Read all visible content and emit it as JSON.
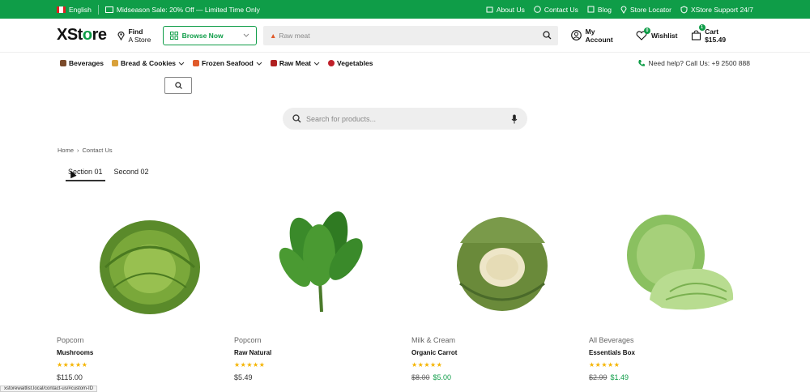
{
  "topbar": {
    "language": "English",
    "promo": "Midseason Sale: 20% Off — Limited Time Only",
    "links": [
      "About Us",
      "Contact Us",
      "Blog",
      "Store Locator",
      "XStore Support 24/7"
    ]
  },
  "header": {
    "logo_prefix": "XSt",
    "logo_o": "o",
    "logo_suffix": "re",
    "find_line1": "Find",
    "find_line2": "A Store",
    "browse_label": "Browse Now",
    "search_placeholder": "Raw meat",
    "account_label": "My Account",
    "wishlist_label": "Wishlist",
    "wishlist_count": "0",
    "cart_label": "Cart $15.49",
    "cart_count": "1"
  },
  "nav": {
    "categories": [
      {
        "label": "Beverages",
        "color": "#7a4a2a"
      },
      {
        "label": "Bread & Cookies",
        "color": "#d9a13a"
      },
      {
        "label": "Frozen Seafood",
        "color": "#e05a2a"
      },
      {
        "label": "Raw Meat",
        "color": "#b02020"
      },
      {
        "label": "Vegetables",
        "color": "#c0202a"
      }
    ],
    "help": "Need help? Call Us: +9 2500 888"
  },
  "product_search": {
    "placeholder": "Search for products..."
  },
  "breadcrumb": {
    "home": "Home",
    "current": "Contact Us"
  },
  "tabs": [
    {
      "label": "Section 01"
    },
    {
      "label": "Second 02"
    }
  ],
  "products": [
    {
      "category": "Popcorn",
      "name": "Mushrooms",
      "old_price": "",
      "price": "$115.00",
      "sale": false,
      "rating": 5
    },
    {
      "category": "Popcorn",
      "name": "Raw Natural",
      "old_price": "",
      "price": "$5.49",
      "sale": false,
      "rating": 5
    },
    {
      "category": "Milk & Cream",
      "name": "Organic Carrot",
      "old_price": "$8.00",
      "price": "$5.00",
      "sale": true,
      "rating": 5
    },
    {
      "category": "All Beverages",
      "name": "Essentials Box",
      "old_price": "$2.99",
      "price": "$1.49",
      "sale": true,
      "rating": 5
    }
  ],
  "statusbar": {
    "url": "xstorewaitlist.local/contact-us/#custom-ID"
  },
  "colors": {
    "brand": "#0f9d48",
    "star": "#f5b400"
  }
}
